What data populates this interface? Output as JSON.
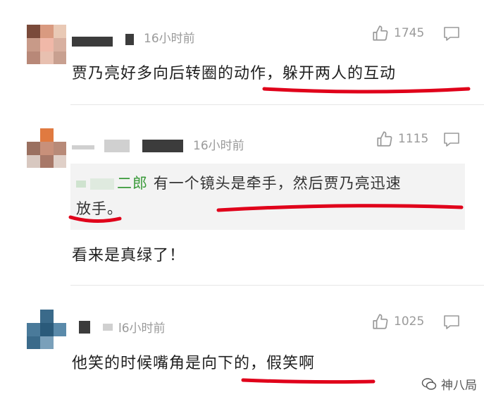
{
  "comments": [
    {
      "time": "16小时前",
      "likes": "1745",
      "text_a": "贾乃亮好多向后转圈的",
      "text_b": "动作，躲开两人的互动"
    },
    {
      "time": "16小时前",
      "likes": "1115",
      "quote_name": "二郎",
      "quote_line1": "有一个镜头是牵手，然后贾乃亮迅速",
      "quote_line2": "放手。",
      "text": "看来是真绿了！"
    },
    {
      "time": "l6小时前",
      "likes": "1025",
      "text_a": "他笑的时候嘴角是向",
      "text_b": "下的，假笑啊"
    }
  ],
  "watermark": "神八局",
  "icons": {
    "like": "thumbs-up-icon",
    "reply": "speech-bubble-icon",
    "watermark": "wechat-icon"
  },
  "colors": {
    "highlight": "#e0001a",
    "quote_name": "#3a9a3a",
    "meta_gray": "#9a9a9a"
  }
}
